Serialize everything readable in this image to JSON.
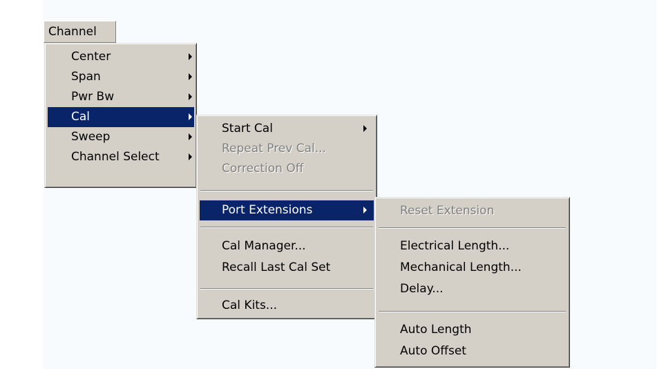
{
  "menubar": {
    "channel_label": "Channel"
  },
  "channel_menu": {
    "items": [
      {
        "label": "Center",
        "submenu": true,
        "selected": false
      },
      {
        "label": "Span",
        "submenu": true,
        "selected": false
      },
      {
        "label": "Pwr Bw",
        "submenu": true,
        "selected": false
      },
      {
        "label": "Cal",
        "submenu": true,
        "selected": true
      },
      {
        "label": "Sweep",
        "submenu": true,
        "selected": false
      },
      {
        "label": "Channel Select",
        "submenu": true,
        "selected": false
      }
    ]
  },
  "cal_menu": {
    "items": [
      {
        "label": "Start Cal",
        "submenu": true,
        "enabled": true
      },
      {
        "label": "Repeat Prev Cal...",
        "submenu": false,
        "enabled": false
      },
      {
        "label": "Correction Off",
        "submenu": false,
        "enabled": false
      },
      {
        "label": "Port Extensions",
        "submenu": true,
        "enabled": true,
        "selected": true
      },
      {
        "label": "Cal Manager...",
        "submenu": false,
        "enabled": true
      },
      {
        "label": "Recall Last Cal Set",
        "submenu": false,
        "enabled": true
      },
      {
        "label": "Cal Kits...",
        "submenu": false,
        "enabled": true
      }
    ]
  },
  "port_ext_menu": {
    "items": [
      {
        "label": "Reset Extension",
        "enabled": false
      },
      {
        "label": "Electrical Length...",
        "enabled": true
      },
      {
        "label": "Mechanical Length...",
        "enabled": true
      },
      {
        "label": "Delay...",
        "enabled": true
      },
      {
        "label": "Auto Length",
        "enabled": true
      },
      {
        "label": "Auto Offset",
        "enabled": true
      }
    ]
  },
  "colors": {
    "highlight": "#0a246a",
    "menu_bg": "#d4d0c8",
    "disabled_text": "#808080"
  }
}
